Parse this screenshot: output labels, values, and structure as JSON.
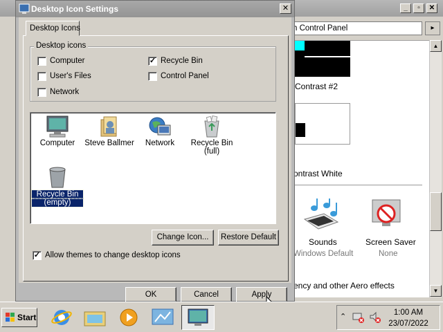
{
  "background_window": {
    "address_text": "h Control Panel",
    "theme_label_1": "Contrast #2",
    "theme_label_2": "ontrast White",
    "sounds_label": "Sounds",
    "sounds_value": "Windows Default",
    "screensaver_label": "Screen Saver",
    "screensaver_value": "None",
    "footer_text": "ency and other Aero effects"
  },
  "dialog": {
    "title": "Desktop Icon Settings",
    "tab_label": "Desktop Icons",
    "group_title": "Desktop icons",
    "checkboxes": [
      {
        "label": "Computer",
        "checked": false
      },
      {
        "label": "User's Files",
        "checked": false
      },
      {
        "label": "Network",
        "checked": false
      },
      {
        "label": "Recycle Bin",
        "checked": true
      },
      {
        "label": "Control Panel",
        "checked": false
      }
    ],
    "icons": [
      {
        "label": "Computer",
        "icon": "computer-icon"
      },
      {
        "label": "Steve Ballmer",
        "icon": "user-folder-icon"
      },
      {
        "label": "Network",
        "icon": "network-icon"
      },
      {
        "label": "Recycle Bin",
        "label2": "(full)",
        "icon": "recycle-bin-full-icon"
      },
      {
        "label": "Recycle Bin",
        "label2": "(empty)",
        "icon": "recycle-bin-empty-icon",
        "selected": true
      }
    ],
    "change_icon_button": "Change Icon...",
    "restore_default_button": "Restore Default",
    "allow_themes_label": "Allow themes to change desktop icons",
    "allow_themes_checked": true,
    "ok_button": "OK",
    "cancel_button": "Cancel",
    "apply_button": "Apply",
    "close_symbol": "✕"
  },
  "taskbar": {
    "start_label": "Start",
    "clock_time": "1:00 AM",
    "clock_date": "23/07/2022"
  },
  "colors": {
    "selection": "#0a246a",
    "dialog_face": "#d4d0c8"
  }
}
